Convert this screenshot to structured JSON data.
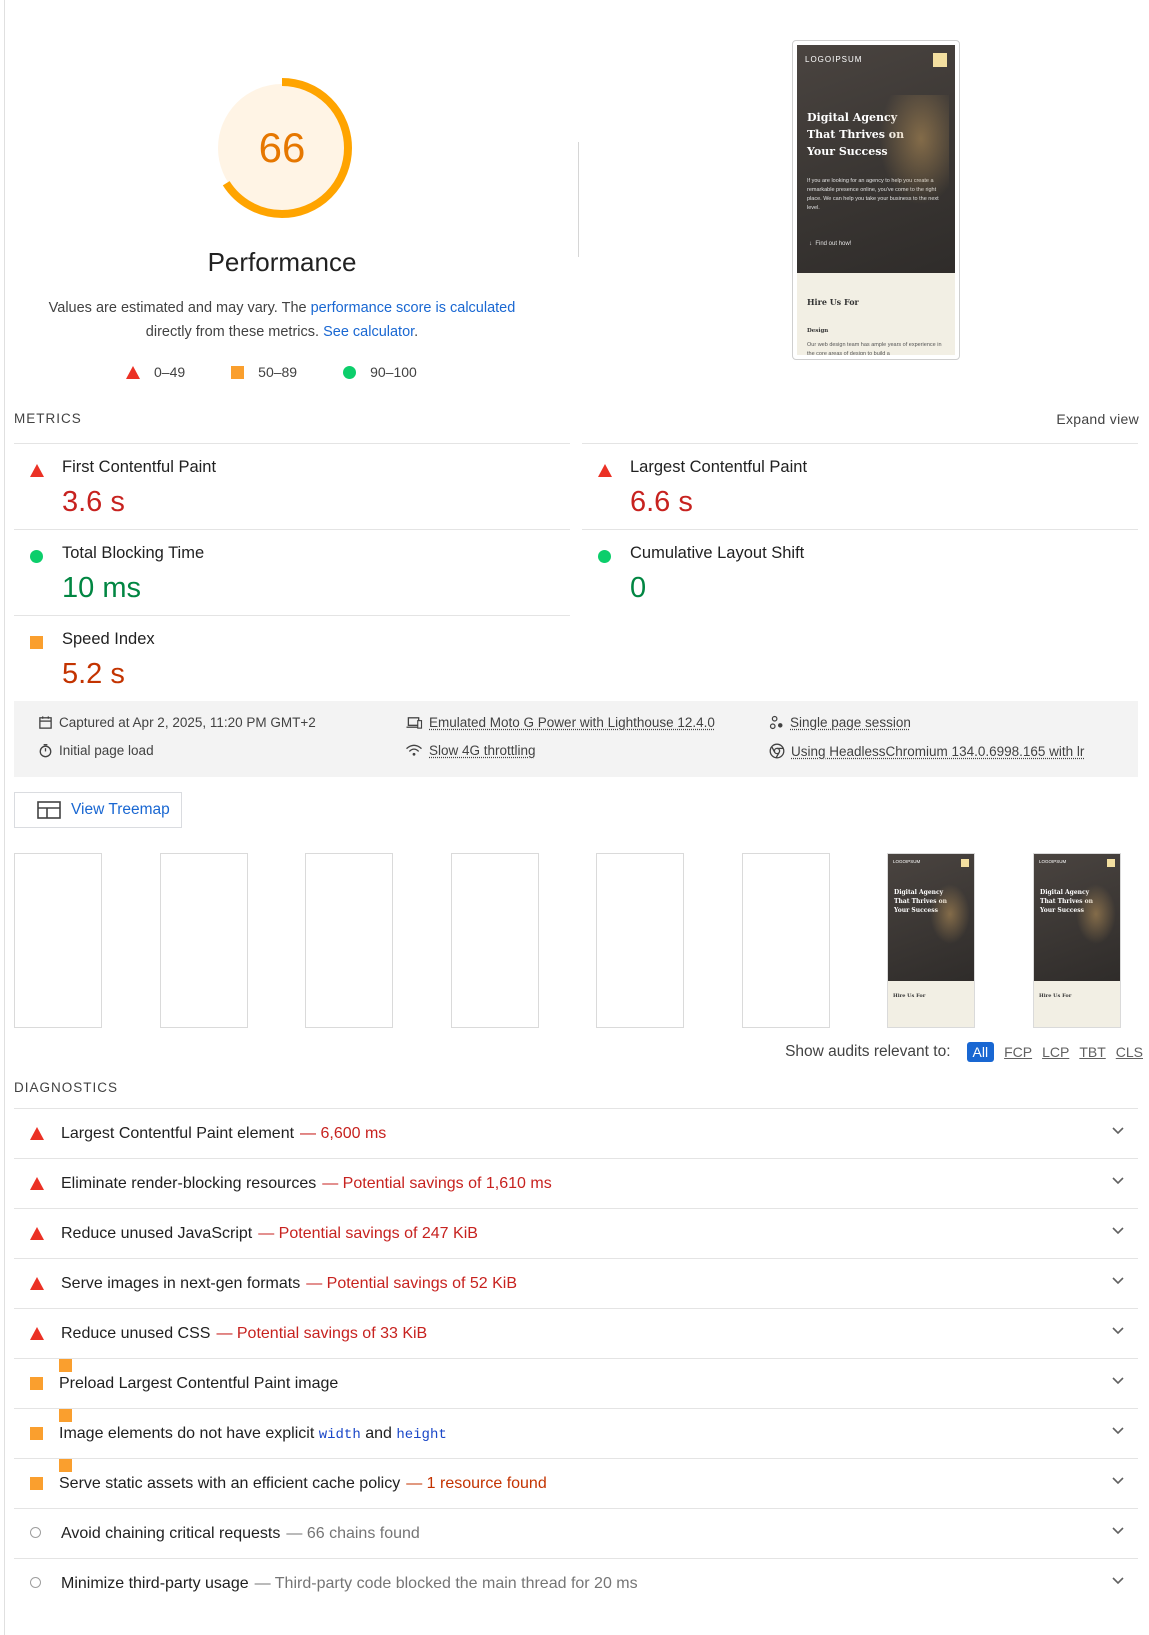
{
  "header": {
    "score": "66",
    "title": "Performance",
    "desc_prefix": "Values are estimated and may vary. The",
    "desc_link1": "performance score is calculated",
    "desc_mid": "directly from these metrics.",
    "desc_link2": "See calculator",
    "desc_suffix": ".",
    "score_color": "#ffa400"
  },
  "legend": [
    {
      "range": "0–49",
      "icon": "triangle-icon",
      "color": "#eb3125"
    },
    {
      "range": "50–89",
      "icon": "square-icon",
      "color": "#fa9f2e"
    },
    {
      "range": "90–100",
      "icon": "circle-icon",
      "color": "#0cce6b"
    }
  ],
  "preview": {
    "logo": "LOGOIPSUM",
    "heading": "Digital Agency That Thrives on Your Success",
    "paragraph": "If you are looking for an agency to help you create a remarkable presence online, you've come to the right place. We can help you take your business to the next level.",
    "cta": "Find out how!",
    "section_title": "Hire Us For",
    "section_sub": "Design",
    "section_text": "Our web design team has ample years of experience in the core areas of design to build a"
  },
  "metrics": {
    "label": "METRICS",
    "expand": "Expand view",
    "items": [
      {
        "title": "First Contentful Paint",
        "value": "3.6 s",
        "status": "fail"
      },
      {
        "title": "Largest Contentful Paint",
        "value": "6.6 s",
        "status": "fail"
      },
      {
        "title": "Total Blocking Time",
        "value": "10 ms",
        "status": "pass"
      },
      {
        "title": "Cumulative Layout Shift",
        "value": "0",
        "status": "pass"
      },
      {
        "title": "Speed Index",
        "value": "5.2 s",
        "status": "average"
      }
    ]
  },
  "env": {
    "captured": "Captured at Apr 2, 2025, 11:20 PM GMT+2",
    "load": "Initial page load",
    "device": "Emulated Moto G Power with Lighthouse 12.4.0",
    "throttle": "Slow 4G throttling",
    "session": "Single page session",
    "browser": "Using HeadlessChromium 134.0.6998.165 with lr"
  },
  "treemap": {
    "label": "View Treemap"
  },
  "filmstrip": {
    "frame_logo": "LOGOIPSUM",
    "frame_heading": "Digital Agency That Thrives on Your Success",
    "frame_section": "Hire Us For"
  },
  "filter": {
    "label": "Show audits relevant to:",
    "options": [
      "All",
      "FCP",
      "LCP",
      "TBT",
      "CLS"
    ]
  },
  "diagnostics": {
    "label": "DIAGNOSTICS",
    "items": [
      {
        "title": "Largest Contentful Paint element",
        "detail": "— 6,600 ms",
        "status": "fail"
      },
      {
        "title": "Eliminate render-blocking resources",
        "detail": "— Potential savings of 1,610 ms",
        "status": "fail"
      },
      {
        "title": "Reduce unused JavaScript",
        "detail": "— Potential savings of 247 KiB",
        "status": "fail"
      },
      {
        "title": "Serve images in next-gen formats",
        "detail": "— Potential savings of 52 KiB",
        "status": "fail"
      },
      {
        "title": "Reduce unused CSS",
        "detail": "— Potential savings of 33 KiB",
        "status": "fail"
      },
      {
        "title": "Preload Largest Contentful Paint image",
        "detail": "",
        "status": "average"
      },
      {
        "title_a": "Image elements do not have explicit",
        "code1": "width",
        "and": "and",
        "code2": "height",
        "status": "average"
      },
      {
        "title": "Serve static assets with an efficient cache policy",
        "detail": "— 1 resource found",
        "status": "average"
      },
      {
        "title": "Avoid chaining critical requests",
        "detail": "— 66 chains found",
        "status": "info"
      },
      {
        "title": "Minimize third-party usage",
        "detail": "— Third-party code blocked the main thread for 20 ms",
        "status": "info"
      }
    ]
  }
}
